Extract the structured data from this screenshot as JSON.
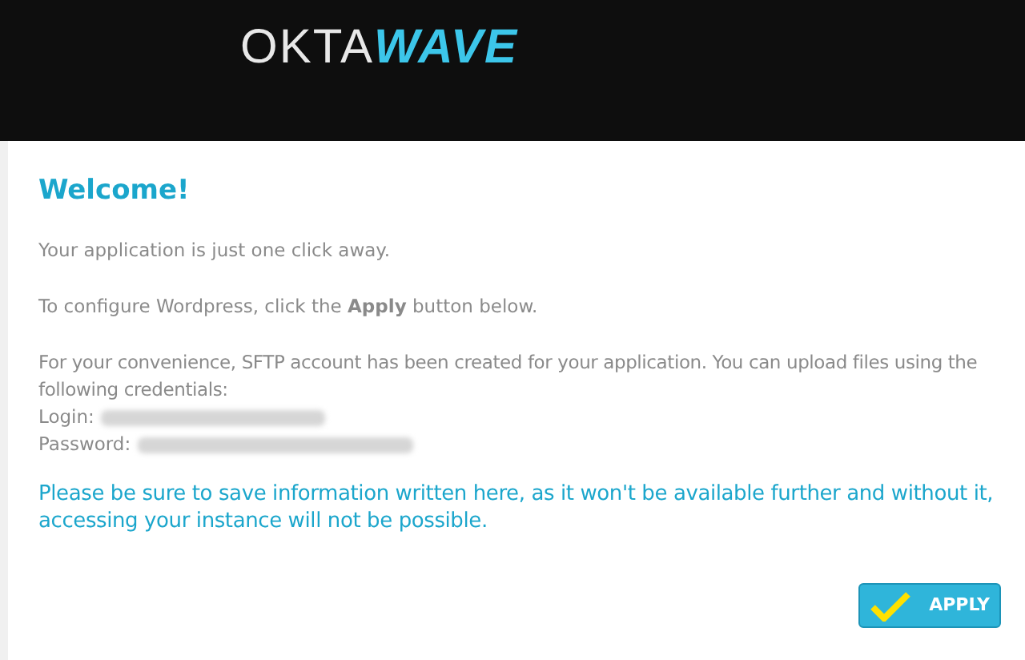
{
  "header": {
    "logo": {
      "left": "OKTA",
      "right": "WAVE"
    }
  },
  "content": {
    "title": "Welcome!",
    "paragraphs": [
      "Your application is just one click away.",
      "To configure Wordpress, click the **Apply** button below."
    ],
    "sftp_note": "For your convenience, SFTP account has been created for your application. You can upload files using the following credentials:",
    "credentials": [
      {
        "label": "Login:"
      },
      {
        "label": "Password:"
      }
    ],
    "warning": "Please be sure to save information written here, as it won't be available further and without it, accessing your instance will not be possible.",
    "apply_button": "APPLY"
  }
}
